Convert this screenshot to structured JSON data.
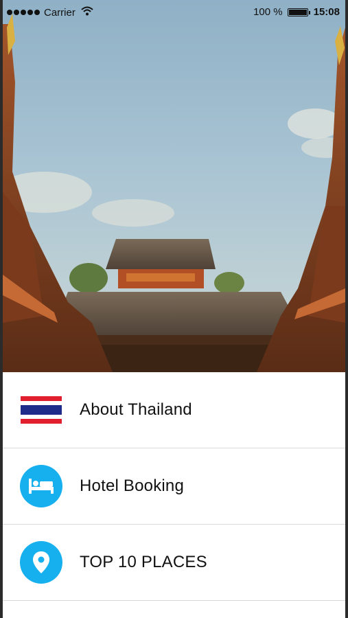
{
  "status_bar": {
    "carrier": "Carrier",
    "battery_text": "100 %",
    "battery_level": 1.0,
    "time": "15:08"
  },
  "hero": {
    "image": "thai-temple-photo"
  },
  "menu": {
    "items": [
      {
        "label": "About Thailand",
        "icon": "thailand-flag-icon"
      },
      {
        "label": "Hotel Booking",
        "icon": "bed-icon"
      },
      {
        "label": "TOP 10 PLACES",
        "icon": "location-pin-icon"
      }
    ]
  },
  "colors": {
    "accent": "#16b0ef",
    "flag_red": "#e0202e",
    "flag_blue": "#1f2c8a",
    "divider": "#d8d8d8"
  }
}
